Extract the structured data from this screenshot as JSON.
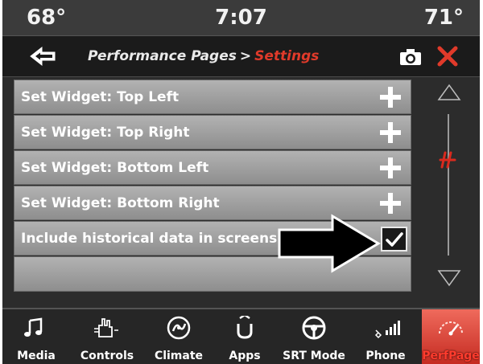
{
  "status": {
    "temp_left": "68°",
    "time": "7:07",
    "temp_right": "71°"
  },
  "header": {
    "title": "Performance Pages",
    "separator": ">",
    "subtitle": "Settings",
    "icons": {
      "back": "back-arrow-icon",
      "camera": "camera-icon",
      "close": "close-icon"
    },
    "colors": {
      "accent": "#e03a2a"
    }
  },
  "settings": {
    "rows": [
      {
        "label": "Set Widget: Top Left",
        "control": "plus-icon"
      },
      {
        "label": "Set Widget: Top Right",
        "control": "plus-icon"
      },
      {
        "label": "Set Widget: Bottom Left",
        "control": "plus-icon"
      },
      {
        "label": "Set Widget: Bottom Right",
        "control": "plus-icon"
      },
      {
        "label": "Include historical data in screenshot",
        "control": "checkbox",
        "checked": true
      }
    ]
  },
  "scrollbar": {
    "up_icon": "scroll-up-icon",
    "down_icon": "scroll-down-icon",
    "thumb_icon": "srt-logo-icon"
  },
  "nav": {
    "items": [
      {
        "label": "Media",
        "icon": "music-note-icon"
      },
      {
        "label": "Controls",
        "icon": "hand-controls-icon"
      },
      {
        "label": "Climate",
        "icon": "climate-fan-icon"
      },
      {
        "label": "Apps",
        "icon": "apps-icon"
      },
      {
        "label": "SRT Mode",
        "icon": "steering-wheel-icon"
      },
      {
        "label": "Phone",
        "icon": "phone-signal-icon"
      },
      {
        "label": "PerfPage",
        "icon": "gauge-icon",
        "active": true
      }
    ]
  }
}
